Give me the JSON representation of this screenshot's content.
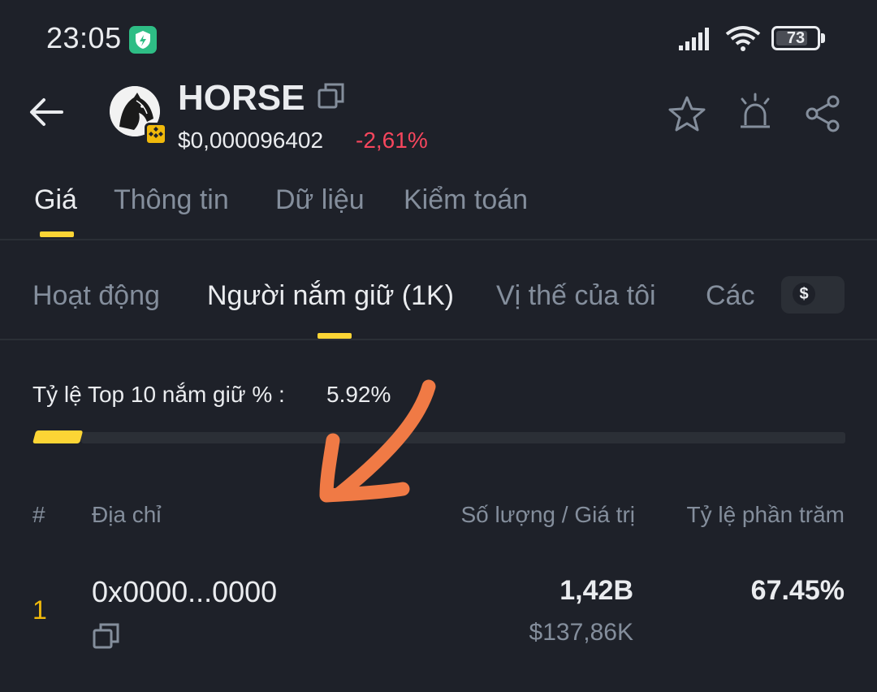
{
  "status_bar": {
    "time": "23:05",
    "battery": "73"
  },
  "token": {
    "name": "HORSE",
    "price": "$0,000096402",
    "change": "-2,61%",
    "change_color": "#f6465d"
  },
  "main_tabs": [
    {
      "label": "Giá",
      "active": true
    },
    {
      "label": "Thông tin"
    },
    {
      "label": "Dữ liệu"
    },
    {
      "label": "Kiểm toán"
    }
  ],
  "sub_tabs": [
    {
      "label": "Hoạt động"
    },
    {
      "label": "Người nắm giữ (1K)",
      "active": true
    },
    {
      "label": "Vị thế của tôi"
    },
    {
      "label": "Các"
    }
  ],
  "currency_toggle": "$",
  "top10": {
    "label": "Tỷ lệ Top 10 nắm giữ % :",
    "value": "5.92%",
    "fraction": 0.0592
  },
  "table": {
    "headers": {
      "rank": "#",
      "address": "Địa chỉ",
      "amount_value": "Số lượng  /  Giá trị",
      "percent": "Tỷ lệ phần trăm"
    },
    "rows": [
      {
        "rank": "1",
        "address": "0x0000...0000",
        "amount": "1,42B",
        "value": "$137,86K",
        "percent": "67.45%"
      }
    ]
  },
  "colors": {
    "background": "#1e2129",
    "accent": "#fcd535",
    "negative": "#f6465d",
    "muted": "#848e9c",
    "annotation": "#f07a45"
  },
  "icons": [
    "back-arrow-icon",
    "copy-icon",
    "star-icon",
    "alarm-icon",
    "share-icon",
    "bnb-chain-icon",
    "wifi-icon",
    "signal-icon",
    "vpn-icon"
  ]
}
